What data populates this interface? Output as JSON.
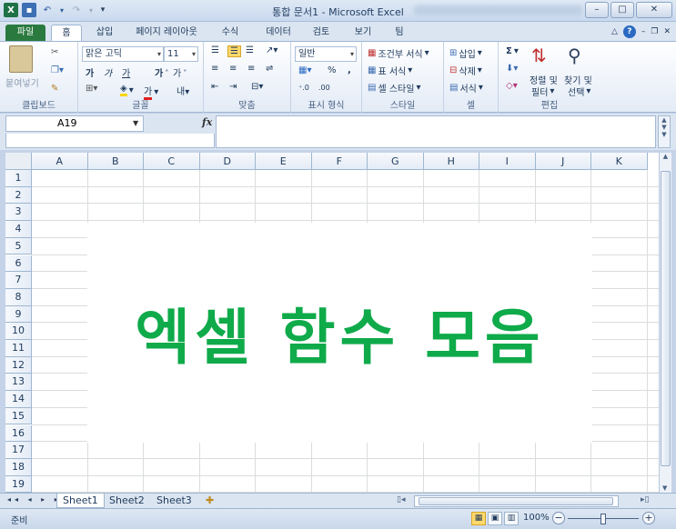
{
  "window": {
    "title": "통합 문서1 - Microsoft Excel",
    "buttons": {
      "minimize": "–",
      "maximize": "□",
      "close": "✕"
    }
  },
  "qat": {
    "excel_icon": "X",
    "save_icon": "💾",
    "undo": "↶",
    "redo": "↷",
    "customize": "▾"
  },
  "tabs": [
    {
      "label": "파일"
    },
    {
      "label": "홈"
    },
    {
      "label": "삽입"
    },
    {
      "label": "페이지 레이아웃"
    },
    {
      "label": "수식"
    },
    {
      "label": "데이터"
    },
    {
      "label": "검토"
    },
    {
      "label": "보기"
    },
    {
      "label": "팀"
    }
  ],
  "ribbon": {
    "clipboard": {
      "label": "클립보드",
      "paste": "붙여넣기"
    },
    "font": {
      "label": "글꼴",
      "font_name": "맑은 고딕",
      "font_size": "11",
      "bold": "가",
      "italic": "가",
      "underline": "가"
    },
    "alignment": {
      "label": "맞춤"
    },
    "number": {
      "label": "표시 형식",
      "format": "일반",
      "percent": "%",
      "comma": ","
    },
    "styles": {
      "label": "스타일",
      "conditional": "조건부 서식",
      "table": "표 서식",
      "cell": "셀 스타일"
    },
    "cells": {
      "label": "셀",
      "insert": "삽입",
      "delete": "삭제",
      "format": "서식"
    },
    "editing": {
      "label": "편집",
      "sort": "정렬 및",
      "filter": "필터",
      "find": "찾기 및",
      "select": "선택",
      "sigma": "Σ"
    }
  },
  "formula_bar": {
    "name_box": "A19",
    "fx": "fx",
    "value": ""
  },
  "grid": {
    "columns": [
      "A",
      "B",
      "C",
      "D",
      "E",
      "F",
      "G",
      "H",
      "I",
      "J",
      "K"
    ],
    "rows": [
      "1",
      "2",
      "3",
      "4",
      "5",
      "6",
      "7",
      "8",
      "9",
      "10",
      "11",
      "12",
      "13",
      "14",
      "15",
      "16",
      "17",
      "18",
      "19"
    ],
    "overlay_text": "엑셀 함수 모음",
    "overlay_color": "#0faa4a"
  },
  "sheets": [
    {
      "label": "Sheet1",
      "active": true
    },
    {
      "label": "Sheet2",
      "active": false
    },
    {
      "label": "Sheet3",
      "active": false
    }
  ],
  "status": {
    "ready": "준비",
    "zoom": "100%"
  }
}
